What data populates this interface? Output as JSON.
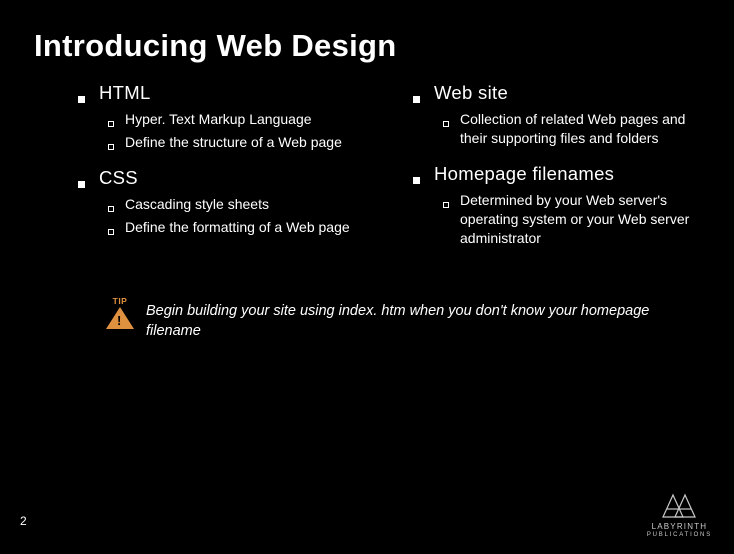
{
  "title": "Introducing Web Design",
  "left": [
    {
      "heading": "HTML",
      "items": [
        "Hyper. Text Markup Language",
        "Define the structure of a Web page"
      ]
    },
    {
      "heading": "CSS",
      "items": [
        "Cascading style sheets",
        "Define the formatting of a Web page"
      ]
    }
  ],
  "right": [
    {
      "heading": "Web site",
      "items": [
        "Collection of related Web pages and their supporting files and folders"
      ]
    },
    {
      "heading": "Homepage filenames",
      "items": [
        "Determined by your Web server's operating system or your Web server administrator"
      ]
    }
  ],
  "tip": {
    "label": "TIP",
    "text": "Begin building your site using index. htm when you don't know your homepage filename"
  },
  "pageNumber": "2",
  "publisher": {
    "name": "LABYRINTH",
    "sub": "PUBLICATIONS"
  }
}
